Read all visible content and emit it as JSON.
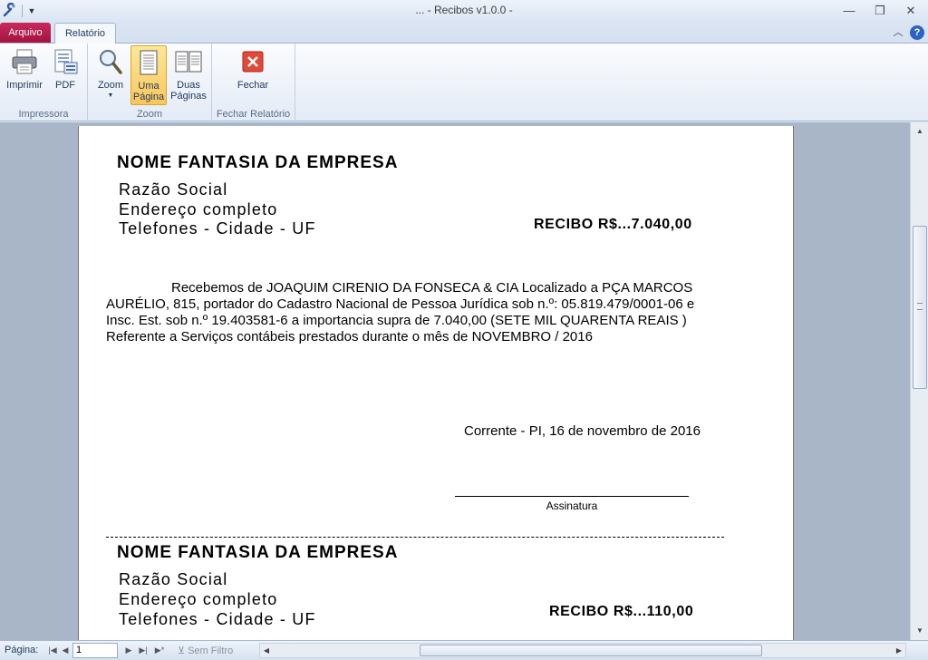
{
  "window": {
    "title": "... - Recibos v1.0.0 -",
    "minimize": "—",
    "maximize": "❐",
    "close": "✕"
  },
  "tabs": {
    "file": "Arquivo",
    "report": "Relatório"
  },
  "ribbon": {
    "groups": {
      "print": "Impressora",
      "zoom": "Zoom",
      "close": "Fechar Relatório"
    },
    "buttons": {
      "print": "Imprimir",
      "pdf": "PDF",
      "zoom": "Zoom",
      "one_page_l1": "Uma",
      "one_page_l2": "Página",
      "two_pages_l1": "Duas",
      "two_pages_l2": "Páginas",
      "close": "Fechar"
    },
    "active_button": "one-page",
    "help": "?"
  },
  "receipts": [
    {
      "company": "NOME FANTASIA DA EMPRESA",
      "legal_name": "Razão Social",
      "address": "Endereço completo",
      "phones": "Telefones - Cidade - UF",
      "amount": "RECIBO  R$...7.040,00",
      "body": "Recebemos de JOAQUIM CIRENIO DA FONSECA & CIA Localizado a PÇA MARCOS AURÉLIO, 815, portador do Cadastro Nacional de Pessoa Jurídica sob n.º: 05.819.479/0001-06 e Insc. Est. sob n.º 19.403581-6 a importancia supra de 7.040,00 (SETE MIL QUARENTA REAIS ) Referente a Serviços contábeis prestados durante o mês de NOVEMBRO / 2016",
      "date": "Corrente - PI, 16 de novembro de 2016",
      "signature": "Assinatura"
    },
    {
      "company": "NOME FANTASIA DA EMPRESA",
      "legal_name": "Razão Social",
      "address": "Endereço completo",
      "phones": "Telefones - Cidade - UF",
      "amount": "RECIBO  R$...110,00"
    }
  ],
  "statusbar": {
    "page_label": "Página:",
    "page_value": "1",
    "filter": "Sem Filtro"
  },
  "colors": {
    "file_tab": "#b41c4a",
    "active_button": "#f9c65e",
    "workspace": "#a9b6c7"
  }
}
